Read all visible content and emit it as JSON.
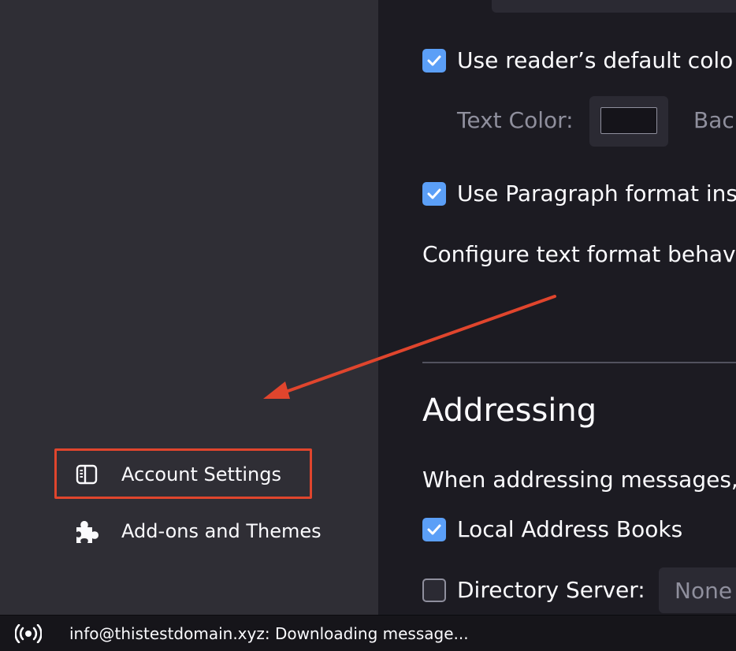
{
  "sidebar": {
    "items": [
      {
        "label": "Account Settings",
        "icon": "account-settings-icon"
      },
      {
        "label": "Add-ons and Themes",
        "icon": "puzzle-piece-icon"
      }
    ]
  },
  "main": {
    "reader_colors": {
      "label": "Use reader’s default colo",
      "checked": true
    },
    "text_color_label": "Text Color:",
    "text_color_value": "#15141a",
    "background_label": "Bac",
    "paragraph_format": {
      "label": "Use Paragraph format ins",
      "checked": true
    },
    "configure_text": "Configure text format behavi",
    "addressing": {
      "title": "Addressing",
      "description": "When addressing messages,",
      "local_address_books": {
        "label": "Local Address Books",
        "checked": true
      },
      "directory_server": {
        "label": "Directory Server:",
        "checked": false,
        "value": "None"
      }
    }
  },
  "status": {
    "icon": "connection-broadcast-icon",
    "text": "info@thistestdomain.xyz: Downloading message..."
  },
  "colors": {
    "accent": "#5b9ff7",
    "annotation": "#e0452d",
    "sidebar_bg": "#2f2e35",
    "main_bg": "#1c1b22"
  }
}
